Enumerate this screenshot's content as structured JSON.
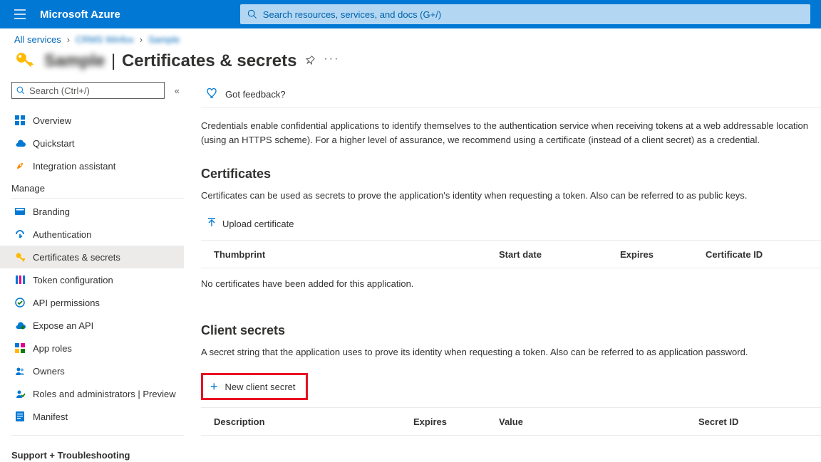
{
  "header": {
    "brand": "Microsoft Azure",
    "search_placeholder": "Search resources, services, and docs (G+/)"
  },
  "breadcrumb": {
    "item1": "All services",
    "item2_blurred": "CRMS Winfox",
    "item3_blurred": "Sample"
  },
  "title": {
    "app_name_blurred": "Sample",
    "page": "Certificates & secrets"
  },
  "sidebar": {
    "search_placeholder": "Search (Ctrl+/)",
    "top_items": [
      {
        "label": "Overview"
      },
      {
        "label": "Quickstart"
      },
      {
        "label": "Integration assistant"
      }
    ],
    "section": "Manage",
    "manage_items": [
      {
        "label": "Branding"
      },
      {
        "label": "Authentication"
      },
      {
        "label": "Certificates & secrets",
        "active": true
      },
      {
        "label": "Token configuration"
      },
      {
        "label": "API permissions"
      },
      {
        "label": "Expose an API"
      },
      {
        "label": "App roles"
      },
      {
        "label": "Owners"
      },
      {
        "label": "Roles and administrators | Preview"
      },
      {
        "label": "Manifest"
      }
    ],
    "support_section": "Support + Troubleshooting"
  },
  "main": {
    "feedback": "Got feedback?",
    "credentials_text": "Credentials enable confidential applications to identify themselves to the authentication service when receiving tokens at a web addressable location (using an HTTPS scheme). For a higher level of assurance, we recommend using a certificate (instead of a client secret) as a credential.",
    "certificates": {
      "heading": "Certificates",
      "description": "Certificates can be used as secrets to prove the application's identity when requesting a token. Also can be referred to as public keys.",
      "upload_button": "Upload certificate",
      "columns": {
        "thumbprint": "Thumbprint",
        "start_date": "Start date",
        "expires": "Expires",
        "cert_id": "Certificate ID"
      },
      "empty": "No certificates have been added for this application."
    },
    "client_secrets": {
      "heading": "Client secrets",
      "description": "A secret string that the application uses to prove its identity when requesting a token. Also can be referred to as application password.",
      "new_button": "New client secret",
      "columns": {
        "description": "Description",
        "expires": "Expires",
        "value": "Value",
        "secret_id": "Secret ID"
      }
    }
  }
}
